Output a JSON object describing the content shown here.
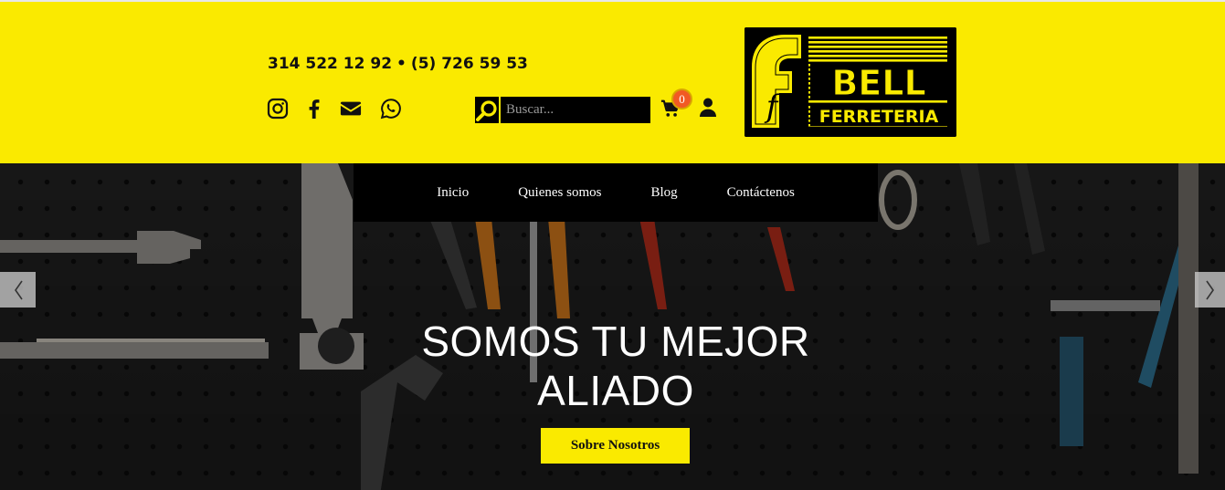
{
  "header": {
    "phone_1": "314 522 12 92",
    "separator": "•",
    "phone_2": "(5) 726 59 53",
    "social_icons": [
      "instagram-icon",
      "facebook-icon",
      "envelope-icon",
      "whatsapp-icon"
    ],
    "search": {
      "placeholder": "Buscar...",
      "value": ""
    },
    "cart_count": "0",
    "logo": {
      "word_1": "BELL",
      "word_2": "FERRETERIA",
      "letter": "f"
    }
  },
  "nav": {
    "items": [
      {
        "label": "Inicio"
      },
      {
        "label": "Quienes somos"
      },
      {
        "label": "Blog"
      },
      {
        "label": "Contáctenos"
      }
    ]
  },
  "hero": {
    "headline_line_1": "SOMOS TU MEJOR",
    "headline_line_2": "ALIADO",
    "cta_label": "Sobre Nosotros"
  },
  "colors": {
    "brand_yellow": "#faea00",
    "black": "#000000",
    "badge_orange": "#f15a24"
  }
}
